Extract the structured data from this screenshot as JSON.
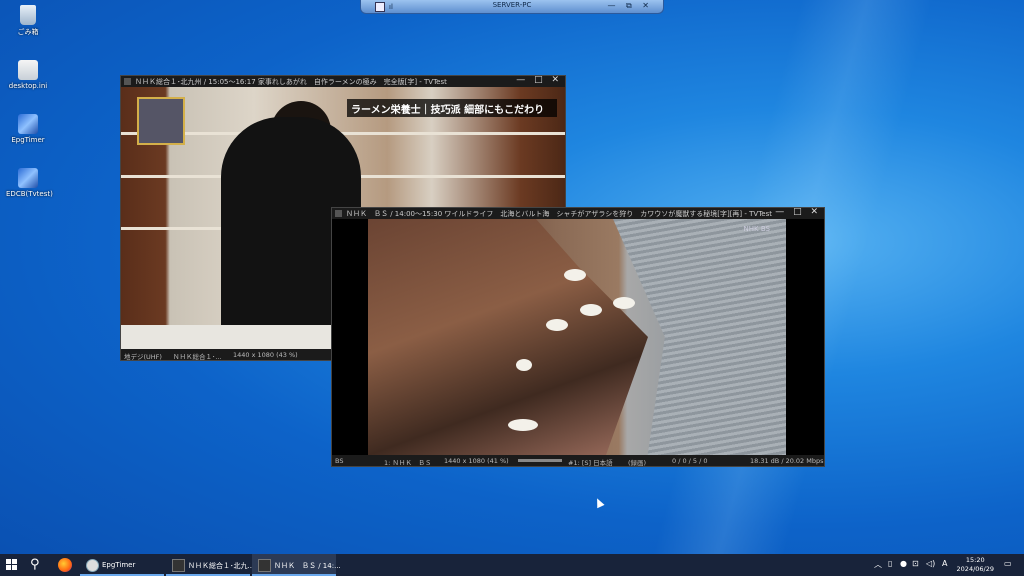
{
  "rdp_bar": {
    "title": "SERVER-PC",
    "signal": "ıl",
    "controls": "— ⧉ ✕"
  },
  "desktop_icons": [
    {
      "label": "ごみ箱",
      "icon": "recycle-bin-icon"
    },
    {
      "label": "desktop.ini",
      "icon": "settings-file-icon"
    },
    {
      "label": "EpgTimer",
      "icon": "pen-shortcut-icon"
    },
    {
      "label": "EDCB(Tvtest)",
      "icon": "pen-shortcut-icon"
    }
  ],
  "window1": {
    "title": "ＮＨＫ総合１･北九州 / 15:05～16:17 家事れしあがれ　自作ラーメンの極み　完全版[字] - TVTest",
    "buttons": "— □ ✕",
    "caption": "ラーメン栄養士｜技巧派 細部にもこだわり",
    "status": {
      "source": "地デジ(UHF)",
      "channel": "ＮＨＫ総合１･…",
      "resolution": "1440 x 1080 (43 %)"
    }
  },
  "window2": {
    "title": "ＮＨＫ　ＢＳ / 14:00～15:30 ワイルドライフ　北海とバルト海　シャチがアザラシを狩り　カワウソが魔獣する秘境[字][再] - TVTest",
    "buttons": "— □ ✕",
    "watermark": "NHK BS",
    "status": {
      "source": "BS",
      "channel": "1: ＮＨＫ　ＢＳ",
      "resolution": "1440 x 1080 (41 %)",
      "audio": "#1: [S] 日本語",
      "audio_mode": "(録画)",
      "errors": "0 / 0 / 5 / 0",
      "signal": "18.31 dB / 20.02 Mbps"
    }
  },
  "taskbar": {
    "items": [
      {
        "label": "EpgTimer",
        "active": false
      },
      {
        "label": "ＮＨＫ総合１･北九...",
        "active": false
      },
      {
        "label": "ＮＨＫ　ＢＳ / 14:...",
        "active": true
      }
    ],
    "tray": {
      "ime": "A",
      "time": "15:20",
      "date": "2024/06/29"
    }
  },
  "colors": {
    "desktop": "#0d63c9",
    "taskbar": "#18233a",
    "accent": "#6aa9ee"
  }
}
